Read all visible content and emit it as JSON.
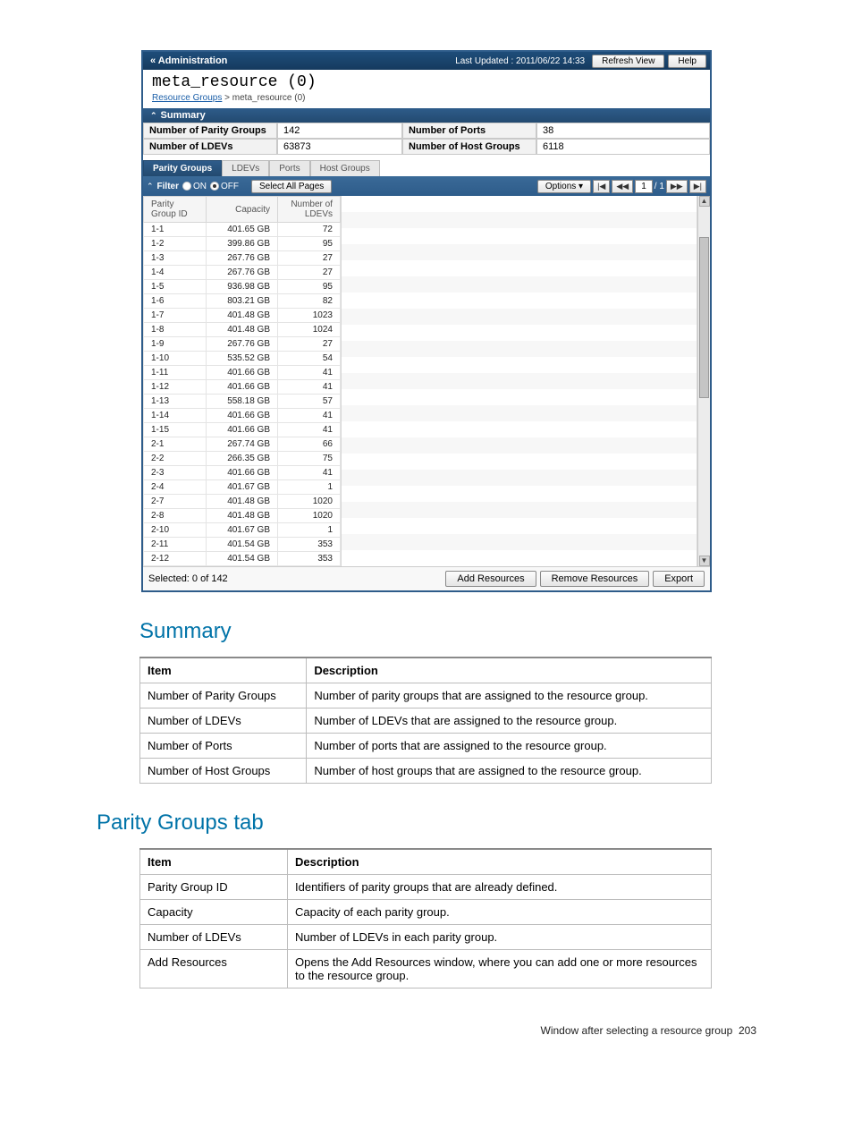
{
  "topbar": {
    "admin": "« Administration",
    "last_updated": "Last Updated : 2011/06/22 14:33",
    "refresh": "Refresh View",
    "help": "Help"
  },
  "title": "meta_resource (0)",
  "breadcrumb": {
    "link": "Resource Groups",
    "sep": " > ",
    "current": "meta_resource (0)"
  },
  "summary_header": "Summary",
  "summary": {
    "left": [
      {
        "label": "Number of Parity Groups",
        "value": "142"
      },
      {
        "label": "Number of LDEVs",
        "value": "63873"
      }
    ],
    "right": [
      {
        "label": "Number of Ports",
        "value": "38"
      },
      {
        "label": "Number of Host Groups",
        "value": "6118"
      }
    ]
  },
  "tabs": [
    "Parity Groups",
    "LDEVs",
    "Ports",
    "Host Groups"
  ],
  "toolbar": {
    "filter": "Filter",
    "on": "ON",
    "off": "OFF",
    "select_all": "Select All Pages",
    "options": "Options",
    "pager_page": "1",
    "pager_total": "/ 1"
  },
  "columns": {
    "pgid": "Parity Group ID",
    "capacity": "Capacity",
    "ldevs": "Number of LDEVs"
  },
  "rows": [
    {
      "id": "1-1",
      "cap": "401.65 GB",
      "n": "72"
    },
    {
      "id": "1-2",
      "cap": "399.86 GB",
      "n": "95"
    },
    {
      "id": "1-3",
      "cap": "267.76 GB",
      "n": "27"
    },
    {
      "id": "1-4",
      "cap": "267.76 GB",
      "n": "27"
    },
    {
      "id": "1-5",
      "cap": "936.98 GB",
      "n": "95"
    },
    {
      "id": "1-6",
      "cap": "803.21 GB",
      "n": "82"
    },
    {
      "id": "1-7",
      "cap": "401.48 GB",
      "n": "1023"
    },
    {
      "id": "1-8",
      "cap": "401.48 GB",
      "n": "1024"
    },
    {
      "id": "1-9",
      "cap": "267.76 GB",
      "n": "27"
    },
    {
      "id": "1-10",
      "cap": "535.52 GB",
      "n": "54"
    },
    {
      "id": "1-11",
      "cap": "401.66 GB",
      "n": "41"
    },
    {
      "id": "1-12",
      "cap": "401.66 GB",
      "n": "41"
    },
    {
      "id": "1-13",
      "cap": "558.18 GB",
      "n": "57"
    },
    {
      "id": "1-14",
      "cap": "401.66 GB",
      "n": "41"
    },
    {
      "id": "1-15",
      "cap": "401.66 GB",
      "n": "41"
    },
    {
      "id": "2-1",
      "cap": "267.74 GB",
      "n": "66"
    },
    {
      "id": "2-2",
      "cap": "266.35 GB",
      "n": "75"
    },
    {
      "id": "2-3",
      "cap": "401.66 GB",
      "n": "41"
    },
    {
      "id": "2-4",
      "cap": "401.67 GB",
      "n": "1"
    },
    {
      "id": "2-7",
      "cap": "401.48 GB",
      "n": "1020"
    },
    {
      "id": "2-8",
      "cap": "401.48 GB",
      "n": "1020"
    },
    {
      "id": "2-10",
      "cap": "401.67 GB",
      "n": "1"
    },
    {
      "id": "2-11",
      "cap": "401.54 GB",
      "n": "353"
    },
    {
      "id": "2-12",
      "cap": "401.54 GB",
      "n": "353"
    }
  ],
  "footer": {
    "selected": "Selected: 0   of 142",
    "add": "Add Resources",
    "remove": "Remove Resources",
    "export": "Export"
  },
  "section_summary": "Summary",
  "summary_table": {
    "hdr_item": "Item",
    "hdr_desc": "Description",
    "rows": [
      {
        "item": "Number of Parity Groups",
        "desc": "Number of parity groups that are assigned to the resource group."
      },
      {
        "item": "Number of LDEVs",
        "desc": "Number of LDEVs that are assigned to the resource group."
      },
      {
        "item": "Number of Ports",
        "desc": "Number of ports that are assigned to the resource group."
      },
      {
        "item": "Number of Host Groups",
        "desc": "Number of host groups that are assigned to the resource group."
      }
    ]
  },
  "section_pg": "Parity Groups tab",
  "pg_table": {
    "hdr_item": "Item",
    "hdr_desc": "Description",
    "rows": [
      {
        "item": "Parity Group ID",
        "desc": "Identifiers of parity groups that are already defined."
      },
      {
        "item": "Capacity",
        "desc": "Capacity of each parity group."
      },
      {
        "item": "Number of LDEVs",
        "desc": "Number of LDEVs in each parity group."
      },
      {
        "item": "Add Resources",
        "desc": "Opens the Add Resources window, where you can add one or more resources to the resource group."
      }
    ]
  },
  "pagefoot": {
    "text": "Window after selecting a resource group",
    "num": "203"
  }
}
